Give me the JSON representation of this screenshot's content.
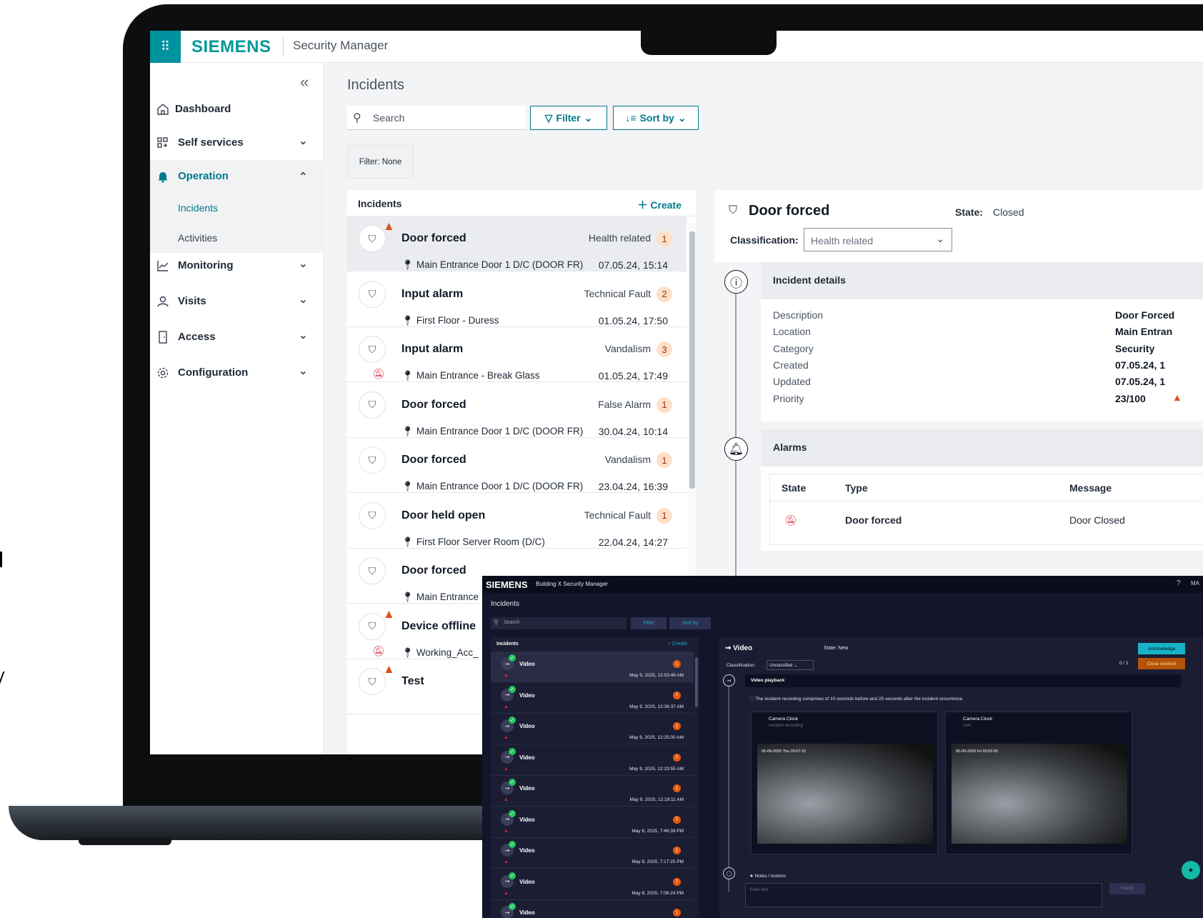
{
  "topbar": {
    "brand": "SIEMENS",
    "app_name": "Security Manager",
    "apps_icon": "grid-icon"
  },
  "sidebar": {
    "items": [
      {
        "label": "Dashboard",
        "icon": "home-icon"
      },
      {
        "label": "Self services",
        "icon": "services-icon"
      },
      {
        "label": "Operation",
        "icon": "bell-icon"
      },
      {
        "label": "Monitoring",
        "icon": "chart-icon"
      },
      {
        "label": "Visits",
        "icon": "person-icon"
      },
      {
        "label": "Access",
        "icon": "door-icon"
      },
      {
        "label": "Configuration",
        "icon": "gear-icon"
      }
    ],
    "sub_items": [
      {
        "label": "Incidents"
      },
      {
        "label": "Activities"
      }
    ]
  },
  "main": {
    "title": "Incidents",
    "search_placeholder": "Search",
    "filter_label": "Filter",
    "sort_label": "Sort by",
    "filter_chip": "Filter:  None"
  },
  "list": {
    "title": "Incidents",
    "create_label": "Create",
    "rows": [
      {
        "name": "Door forced",
        "category": "Health related",
        "count": "1",
        "location": "Main Entrance Door 1 D/C (DOOR FR)",
        "date": "07.05.24, 15:14"
      },
      {
        "name": "Input alarm",
        "category": "Technical Fault",
        "count": "2",
        "location": "First Floor - Duress",
        "date": "01.05.24, 17:50"
      },
      {
        "name": "Input alarm",
        "category": "Vandalism",
        "count": "3",
        "location": "Main Entrance - Break Glass",
        "date": "01.05.24, 17:49"
      },
      {
        "name": "Door forced",
        "category": "False Alarm",
        "count": "1",
        "location": "Main Entrance Door 1 D/C (DOOR FR)",
        "date": "30.04.24, 10:14"
      },
      {
        "name": "Door forced",
        "category": "Vandalism",
        "count": "1",
        "location": "Main Entrance Door 1 D/C (DOOR FR)",
        "date": "23.04.24, 16:39"
      },
      {
        "name": "Door held open",
        "category": "Technical Fault",
        "count": "1",
        "location": "First Floor Server Room (D/C)",
        "date": "22.04.24, 14:27"
      },
      {
        "name": "Door forced",
        "category": "",
        "count": "",
        "location": "Main Entrance",
        "date": ""
      },
      {
        "name": "Device offline",
        "category": "",
        "count": "",
        "location": "Working_Acc_",
        "date": ""
      },
      {
        "name": "Test",
        "category": "",
        "count": "",
        "location": "",
        "date": ""
      }
    ]
  },
  "detail": {
    "title": "Door forced",
    "state_label": "State:",
    "state_value": "Closed",
    "classification_label": "Classification:",
    "classification_value": "Health related",
    "details_title": "Incident details",
    "fields": [
      {
        "key": "Description",
        "value": "Door Forced"
      },
      {
        "key": "Location",
        "value": "Main Entran"
      },
      {
        "key": "Category",
        "value": "Security"
      },
      {
        "key": "Created",
        "value": "07.05.24, 1"
      },
      {
        "key": "Updated",
        "value": "07.05.24, 1"
      },
      {
        "key": "Priority",
        "value": "23/100"
      }
    ],
    "alarms_title": "Alarms",
    "alarm_columns": [
      "State",
      "Type",
      "Message"
    ],
    "alarm_row": {
      "type": "Door forced",
      "message": "Door Closed"
    }
  },
  "dark": {
    "brand": "SIEMENS",
    "app_name": "Building X Security Manager",
    "user": "MA",
    "title": "Incidents",
    "search_placeholder": "Search",
    "filter_label": "Filter",
    "sort_label": "Sort by",
    "list_title": "Incidents",
    "create_label": "+ Create",
    "rows": [
      {
        "name": "Video",
        "count": "1",
        "date": "May 9, 2025, 12:53:49 AM"
      },
      {
        "name": "Video",
        "count": "1",
        "date": "May 9, 2025, 12:36:37 AM"
      },
      {
        "name": "Video",
        "count": "1",
        "date": "May 9, 2025, 12:25:00 AM"
      },
      {
        "name": "Video",
        "count": "1",
        "date": "May 9, 2025, 12:23:55 AM"
      },
      {
        "name": "Video",
        "count": "1",
        "date": "May 9, 2025, 12:18:11 AM"
      },
      {
        "name": "Video",
        "count": "1",
        "date": "May 8, 2025, 7:46:39 PM"
      },
      {
        "name": "Video",
        "count": "1",
        "date": "May 8, 2025, 7:17:25 PM"
      },
      {
        "name": "Video",
        "count": "1",
        "date": "May 8, 2025, 7:08:24 PM"
      },
      {
        "name": "Video",
        "count": "1",
        "date": ""
      }
    ],
    "detail": {
      "title": "Video",
      "state": "State:  New",
      "classification_label": "Classification:",
      "classification_value": "Unclassified",
      "acknowledge": "Acknowledge",
      "close_incident": "Close incident",
      "count": "0 / 1",
      "playback_title": "Video playback",
      "info": "The incident recording comprises of 10 seconds before and 25 seconds after the incident occurrence.",
      "cameras": [
        {
          "name": "Camera Clock",
          "status": "Incident recording",
          "stamp": "05-09-2025 Thu 20:07:15"
        },
        {
          "name": "Camera Clock",
          "status": "Live",
          "stamp": "05-09-2025 Fri 03:03:05"
        }
      ],
      "notes_title": "Notes / Actions",
      "notes_placeholder": "Enter text",
      "submit": "Submit"
    }
  }
}
